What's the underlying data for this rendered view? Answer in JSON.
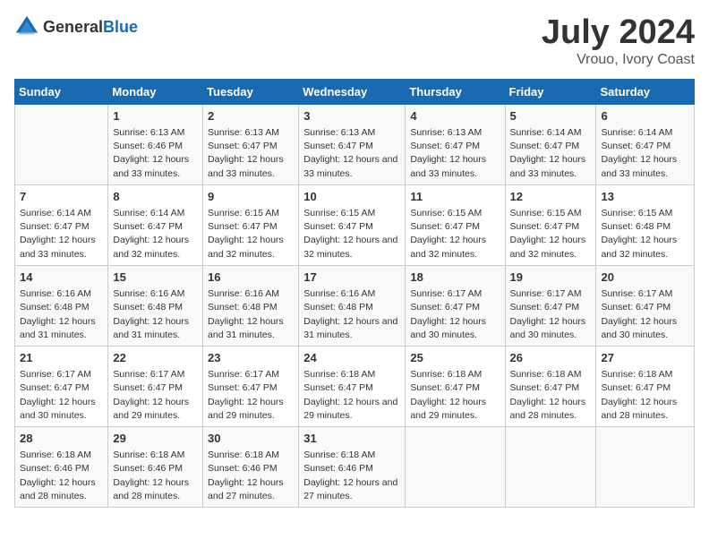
{
  "logo": {
    "general": "General",
    "blue": "Blue"
  },
  "title": {
    "month_year": "July 2024",
    "location": "Vrouo, Ivory Coast"
  },
  "days_of_week": [
    "Sunday",
    "Monday",
    "Tuesday",
    "Wednesday",
    "Thursday",
    "Friday",
    "Saturday"
  ],
  "weeks": [
    [
      {
        "day": "",
        "sunrise": "",
        "sunset": "",
        "daylight": ""
      },
      {
        "day": "1",
        "sunrise": "Sunrise: 6:13 AM",
        "sunset": "Sunset: 6:46 PM",
        "daylight": "Daylight: 12 hours and 33 minutes."
      },
      {
        "day": "2",
        "sunrise": "Sunrise: 6:13 AM",
        "sunset": "Sunset: 6:47 PM",
        "daylight": "Daylight: 12 hours and 33 minutes."
      },
      {
        "day": "3",
        "sunrise": "Sunrise: 6:13 AM",
        "sunset": "Sunset: 6:47 PM",
        "daylight": "Daylight: 12 hours and 33 minutes."
      },
      {
        "day": "4",
        "sunrise": "Sunrise: 6:13 AM",
        "sunset": "Sunset: 6:47 PM",
        "daylight": "Daylight: 12 hours and 33 minutes."
      },
      {
        "day": "5",
        "sunrise": "Sunrise: 6:14 AM",
        "sunset": "Sunset: 6:47 PM",
        "daylight": "Daylight: 12 hours and 33 minutes."
      },
      {
        "day": "6",
        "sunrise": "Sunrise: 6:14 AM",
        "sunset": "Sunset: 6:47 PM",
        "daylight": "Daylight: 12 hours and 33 minutes."
      }
    ],
    [
      {
        "day": "7",
        "sunrise": "Sunrise: 6:14 AM",
        "sunset": "Sunset: 6:47 PM",
        "daylight": "Daylight: 12 hours and 33 minutes."
      },
      {
        "day": "8",
        "sunrise": "Sunrise: 6:14 AM",
        "sunset": "Sunset: 6:47 PM",
        "daylight": "Daylight: 12 hours and 32 minutes."
      },
      {
        "day": "9",
        "sunrise": "Sunrise: 6:15 AM",
        "sunset": "Sunset: 6:47 PM",
        "daylight": "Daylight: 12 hours and 32 minutes."
      },
      {
        "day": "10",
        "sunrise": "Sunrise: 6:15 AM",
        "sunset": "Sunset: 6:47 PM",
        "daylight": "Daylight: 12 hours and 32 minutes."
      },
      {
        "day": "11",
        "sunrise": "Sunrise: 6:15 AM",
        "sunset": "Sunset: 6:47 PM",
        "daylight": "Daylight: 12 hours and 32 minutes."
      },
      {
        "day": "12",
        "sunrise": "Sunrise: 6:15 AM",
        "sunset": "Sunset: 6:47 PM",
        "daylight": "Daylight: 12 hours and 32 minutes."
      },
      {
        "day": "13",
        "sunrise": "Sunrise: 6:15 AM",
        "sunset": "Sunset: 6:48 PM",
        "daylight": "Daylight: 12 hours and 32 minutes."
      }
    ],
    [
      {
        "day": "14",
        "sunrise": "Sunrise: 6:16 AM",
        "sunset": "Sunset: 6:48 PM",
        "daylight": "Daylight: 12 hours and 31 minutes."
      },
      {
        "day": "15",
        "sunrise": "Sunrise: 6:16 AM",
        "sunset": "Sunset: 6:48 PM",
        "daylight": "Daylight: 12 hours and 31 minutes."
      },
      {
        "day": "16",
        "sunrise": "Sunrise: 6:16 AM",
        "sunset": "Sunset: 6:48 PM",
        "daylight": "Daylight: 12 hours and 31 minutes."
      },
      {
        "day": "17",
        "sunrise": "Sunrise: 6:16 AM",
        "sunset": "Sunset: 6:48 PM",
        "daylight": "Daylight: 12 hours and 31 minutes."
      },
      {
        "day": "18",
        "sunrise": "Sunrise: 6:17 AM",
        "sunset": "Sunset: 6:47 PM",
        "daylight": "Daylight: 12 hours and 30 minutes."
      },
      {
        "day": "19",
        "sunrise": "Sunrise: 6:17 AM",
        "sunset": "Sunset: 6:47 PM",
        "daylight": "Daylight: 12 hours and 30 minutes."
      },
      {
        "day": "20",
        "sunrise": "Sunrise: 6:17 AM",
        "sunset": "Sunset: 6:47 PM",
        "daylight": "Daylight: 12 hours and 30 minutes."
      }
    ],
    [
      {
        "day": "21",
        "sunrise": "Sunrise: 6:17 AM",
        "sunset": "Sunset: 6:47 PM",
        "daylight": "Daylight: 12 hours and 30 minutes."
      },
      {
        "day": "22",
        "sunrise": "Sunrise: 6:17 AM",
        "sunset": "Sunset: 6:47 PM",
        "daylight": "Daylight: 12 hours and 29 minutes."
      },
      {
        "day": "23",
        "sunrise": "Sunrise: 6:17 AM",
        "sunset": "Sunset: 6:47 PM",
        "daylight": "Daylight: 12 hours and 29 minutes."
      },
      {
        "day": "24",
        "sunrise": "Sunrise: 6:18 AM",
        "sunset": "Sunset: 6:47 PM",
        "daylight": "Daylight: 12 hours and 29 minutes."
      },
      {
        "day": "25",
        "sunrise": "Sunrise: 6:18 AM",
        "sunset": "Sunset: 6:47 PM",
        "daylight": "Daylight: 12 hours and 29 minutes."
      },
      {
        "day": "26",
        "sunrise": "Sunrise: 6:18 AM",
        "sunset": "Sunset: 6:47 PM",
        "daylight": "Daylight: 12 hours and 28 minutes."
      },
      {
        "day": "27",
        "sunrise": "Sunrise: 6:18 AM",
        "sunset": "Sunset: 6:47 PM",
        "daylight": "Daylight: 12 hours and 28 minutes."
      }
    ],
    [
      {
        "day": "28",
        "sunrise": "Sunrise: 6:18 AM",
        "sunset": "Sunset: 6:46 PM",
        "daylight": "Daylight: 12 hours and 28 minutes."
      },
      {
        "day": "29",
        "sunrise": "Sunrise: 6:18 AM",
        "sunset": "Sunset: 6:46 PM",
        "daylight": "Daylight: 12 hours and 28 minutes."
      },
      {
        "day": "30",
        "sunrise": "Sunrise: 6:18 AM",
        "sunset": "Sunset: 6:46 PM",
        "daylight": "Daylight: 12 hours and 27 minutes."
      },
      {
        "day": "31",
        "sunrise": "Sunrise: 6:18 AM",
        "sunset": "Sunset: 6:46 PM",
        "daylight": "Daylight: 12 hours and 27 minutes."
      },
      {
        "day": "",
        "sunrise": "",
        "sunset": "",
        "daylight": ""
      },
      {
        "day": "",
        "sunrise": "",
        "sunset": "",
        "daylight": ""
      },
      {
        "day": "",
        "sunrise": "",
        "sunset": "",
        "daylight": ""
      }
    ]
  ]
}
